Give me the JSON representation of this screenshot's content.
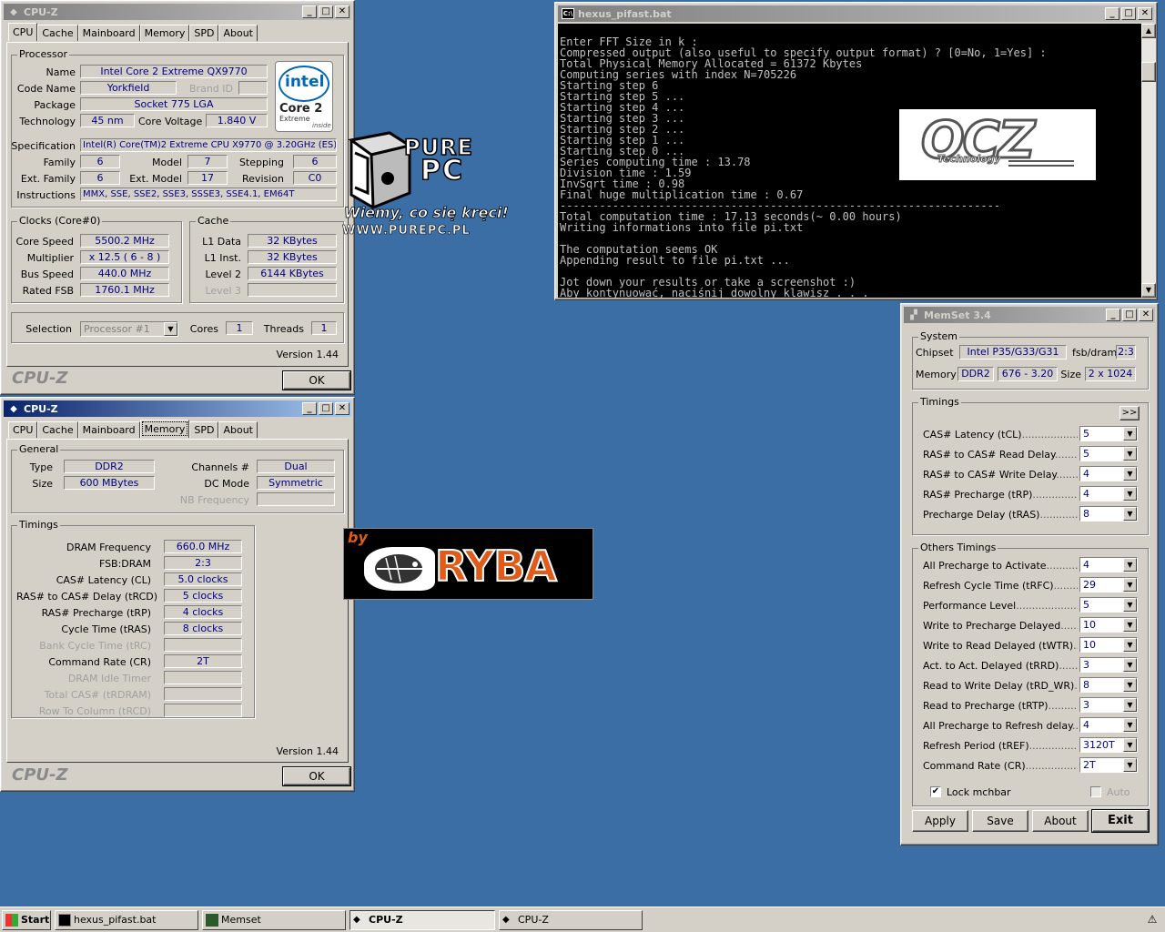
{
  "cpuz1": {
    "title": "CPU-Z",
    "tabs": [
      "CPU",
      "Cache",
      "Mainboard",
      "Memory",
      "SPD",
      "About"
    ],
    "processor_group": "Processor",
    "name_label": "Name",
    "name": "Intel Core 2 Extreme QX9770",
    "codename_label": "Code Name",
    "codename": "Yorkfield",
    "brandid_label": "Brand ID",
    "package_label": "Package",
    "package": "Socket 775 LGA",
    "technology_label": "Technology",
    "technology": "45 nm",
    "corevoltage_label": "Core Voltage",
    "corevoltage": "1.840 V",
    "spec_label": "Specification",
    "spec": "Intel(R) Core(TM)2 Extreme CPU X9770  @ 3.20GHz (ES)",
    "family_label": "Family",
    "family": "6",
    "model_label": "Model",
    "model": "7",
    "stepping_label": "Stepping",
    "stepping": "6",
    "extfamily_label": "Ext. Family",
    "extfamily": "6",
    "extmodel_label": "Ext. Model",
    "extmodel": "17",
    "revision_label": "Revision",
    "revision": "C0",
    "instructions_label": "Instructions",
    "instructions": "MMX, SSE, SSE2, SSE3, SSSE3, SSE4.1, EM64T",
    "clocks_group": "Clocks (Core#0)",
    "corespeed_label": "Core Speed",
    "corespeed": "5500.2 MHz",
    "multiplier_label": "Multiplier",
    "multiplier": "x 12.5 ( 6 - 8 )",
    "busspeed_label": "Bus Speed",
    "busspeed": "440.0 MHz",
    "ratedfsb_label": "Rated FSB",
    "ratedfsb": "1760.1 MHz",
    "cache_group": "Cache",
    "l1data_label": "L1 Data",
    "l1data": "32 KBytes",
    "l1inst_label": "L1 Inst.",
    "l1inst": "32 KBytes",
    "level2_label": "Level 2",
    "level2": "6144 KBytes",
    "level3_label": "Level 3",
    "selection_label": "Selection",
    "selection": "Processor #1",
    "cores_label": "Cores",
    "cores": "1",
    "threads_label": "Threads",
    "threads": "1",
    "version": "Version 1.44",
    "brand": "CPU-Z",
    "ok": "OK",
    "intel_logo": {
      "word": "intel",
      "line1": "Core 2",
      "line2": "Extreme",
      "line3": "inside"
    }
  },
  "cpuz2": {
    "title": "CPU-Z",
    "tabs": [
      "CPU",
      "Cache",
      "Mainboard",
      "Memory",
      "SPD",
      "About"
    ],
    "general_group": "General",
    "type_label": "Type",
    "type": "DDR2",
    "size_label": "Size",
    "size": "600 MBytes",
    "channels_label": "Channels #",
    "channels": "Dual",
    "dcmode_label": "DC Mode",
    "dcmode": "Symmetric",
    "nbfreq_label": "NB Frequency",
    "timings_group": "Timings",
    "rows": [
      {
        "label": "DRAM Frequency",
        "value": "660.0 MHz",
        "dis": false
      },
      {
        "label": "FSB:DRAM",
        "value": "2:3",
        "dis": false
      },
      {
        "label": "CAS# Latency (CL)",
        "value": "5.0 clocks",
        "dis": false
      },
      {
        "label": "RAS# to CAS# Delay (tRCD)",
        "value": "5 clocks",
        "dis": false
      },
      {
        "label": "RAS# Precharge (tRP)",
        "value": "4 clocks",
        "dis": false
      },
      {
        "label": "Cycle Time (tRAS)",
        "value": "8 clocks",
        "dis": false
      },
      {
        "label": "Bank Cycle Time (tRC)",
        "value": "",
        "dis": true
      },
      {
        "label": "Command Rate (CR)",
        "value": "2T",
        "dis": false
      },
      {
        "label": "DRAM Idle Timer",
        "value": "",
        "dis": true
      },
      {
        "label": "Total CAS# (tRDRAM)",
        "value": "",
        "dis": true
      },
      {
        "label": "Row To Column (tRCD)",
        "value": "",
        "dis": true
      }
    ],
    "version": "Version 1.44",
    "brand": "CPU-Z",
    "ok": "OK"
  },
  "console": {
    "title": "hexus_pifast.bat",
    "lines": [
      "Enter FFT Size in k :",
      "Compressed output (also useful to specify output format) ? [0=No, 1=Yes] :",
      "Total Physical Memory Allocated = 61372 Kbytes",
      "Computing series with index N=705226",
      "Starting step 6",
      "Starting step 5 ...",
      "Starting step 4 ...",
      "Starting step 3 ...",
      "Starting step 2 ...",
      "Starting step 1 ...",
      "Starting step 0 ...",
      "Series computing time : 13.78",
      "Division time : 1.59",
      "InvSqrt time : 0.98",
      "Final huge multiplication time : 0.67",
      "-------------------------------------------------------------------",
      "Total computation time : 17.13 seconds(~ 0.00 hours)",
      "Writing informations into file pi.txt",
      "",
      "The computation seems OK",
      "Appending result to file pi.txt ...",
      "",
      "Jot down your results or take a screenshot :)",
      "Aby kontynuować, naciśnij dowolny klawisz . . ."
    ]
  },
  "memset": {
    "title": "MemSet 3.4",
    "system_group": "System",
    "chipset_label": "Chipset",
    "chipset": "Intel P35/G33/G31",
    "fsbdram_label": "fsb/dram",
    "fsbdram": "2:3",
    "memory_label": "Memory",
    "memtype": "DDR2",
    "memfreq": "676 - 3.20",
    "size_label": "Size",
    "size": "2 x 1024",
    "timings_group": "Timings",
    "expand": ">>",
    "timings": [
      {
        "label": "CAS# Latency (tCL)",
        "value": "5"
      },
      {
        "label": "RAS# to CAS# Read Delay",
        "value": "5"
      },
      {
        "label": "RAS# to CAS# Write Delay",
        "value": "4"
      },
      {
        "label": "RAS# Precharge (tRP)",
        "value": "4"
      },
      {
        "label": "Precharge Delay  (tRAS)",
        "value": "8"
      }
    ],
    "others_group": "Others Timings",
    "others": [
      {
        "label": "All Precharge to Activate",
        "value": "4"
      },
      {
        "label": "Refresh Cycle Time (tRFC)",
        "value": "29"
      },
      {
        "label": "Performance Level",
        "value": "5"
      },
      {
        "label": "Write to Precharge Delayed",
        "value": "10"
      },
      {
        "label": "Write to Read Delayed (tWTR)",
        "value": "10"
      },
      {
        "label": "Act. to Act. Delayed (tRRD)",
        "value": "3"
      },
      {
        "label": "Read to Write Delay (tRD_WR)",
        "value": "8"
      },
      {
        "label": "Read to Precharge (tRTP)",
        "value": "3"
      },
      {
        "label": "All Precharge to Refresh delay",
        "value": "4"
      },
      {
        "label": "Refresh Period (tREF)",
        "value": "3120T"
      },
      {
        "label": "Command Rate (CR)",
        "value": "2T"
      }
    ],
    "lock_label": "Lock mchbar",
    "auto_label": "Auto",
    "apply": "Apply",
    "save": "Save",
    "about": "About",
    "exit": "Exit"
  },
  "logos": {
    "purepc1": "PURE",
    "purepc2": "PC",
    "purepc_slogan": "Wiemy, co się kręci!",
    "purepc_url": "WWW.PUREPC.PL",
    "ocz": "OCZ",
    "ocz_sub": "Technology",
    "ryba_by": "by",
    "ryba": "RYBA"
  },
  "taskbar": {
    "start": "Start",
    "items": [
      "hexus_pifast.bat",
      "Memset",
      "CPU-Z",
      "CPU-Z"
    ]
  }
}
